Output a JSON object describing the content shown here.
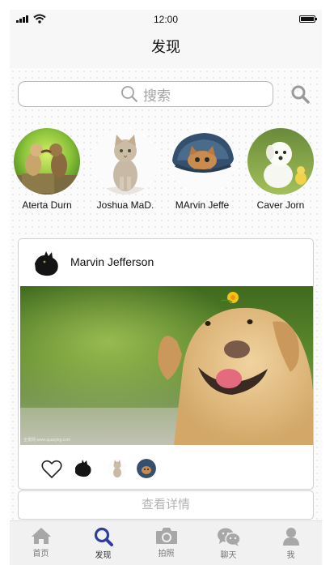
{
  "status_bar": {
    "time": "12:00"
  },
  "nav": {
    "title": "发现"
  },
  "search": {
    "placeholder": "搜索"
  },
  "stories": [
    {
      "name": "Aterta Durn",
      "image": "two-monkeys-photo"
    },
    {
      "name": "Joshua MaD.",
      "image": "kitten-photo"
    },
    {
      "name": "MArvin Jeffe",
      "image": "cat-in-hat-photo"
    },
    {
      "name": "Caver Jorn",
      "image": "puppy-and-chick-photo"
    }
  ],
  "post": {
    "author": "Marvin Jefferson",
    "avatar": "black-cat-silhouette",
    "image": "golden-labrador-with-flower-photo",
    "watermark": "全景网 www.quanjing.com",
    "like_icon": "heart-outline-icon",
    "likers": [
      "black-cat-silhouette",
      "kitten-photo",
      "cat-in-hat-photo"
    ]
  },
  "detail_button": {
    "label": "查看详情"
  },
  "tabs": [
    {
      "label": "首页",
      "icon": "home-icon",
      "active": false
    },
    {
      "label": "发现",
      "icon": "search-icon",
      "active": true
    },
    {
      "label": "拍照",
      "icon": "camera-icon",
      "active": false
    },
    {
      "label": "聊天",
      "icon": "wechat-chat-icon",
      "active": false
    },
    {
      "label": "我",
      "icon": "person-icon",
      "active": false
    }
  ],
  "colors": {
    "active_tab": "#2f3d9e",
    "inactive_tab": "#a7a7a7",
    "search_border": "#b9b9b9"
  }
}
